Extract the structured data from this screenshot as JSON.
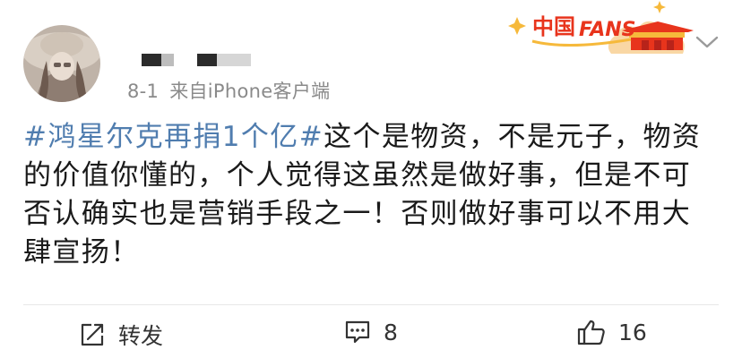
{
  "post": {
    "date": "8-1",
    "source": "来自iPhone客户端",
    "hashtag": "#鸿星尔克再捐1个亿#",
    "body": "这个是物资，不是元子，物资的价值你懂的，个人觉得这虽然是做好事，但是不可否认确实也是营销手段之一！否则做好事可以不用大肆宣扬！"
  },
  "badge": {
    "text": "中国FANS",
    "icon": "china-fans-badge-icon"
  },
  "actions": {
    "repost_label": "转发",
    "comment_count": "8",
    "like_count": "16"
  },
  "icons": {
    "avatar": "avatar",
    "collapse": "chevron-down-icon",
    "repost": "repost-icon",
    "comment": "comment-icon",
    "like": "thumbs-up-icon"
  },
  "colors": {
    "hashtag": "#507daf",
    "meta": "#8a8a8a",
    "text": "#1a1a1a",
    "badge_red": "#e8341c",
    "badge_gold": "#f6b93b"
  }
}
